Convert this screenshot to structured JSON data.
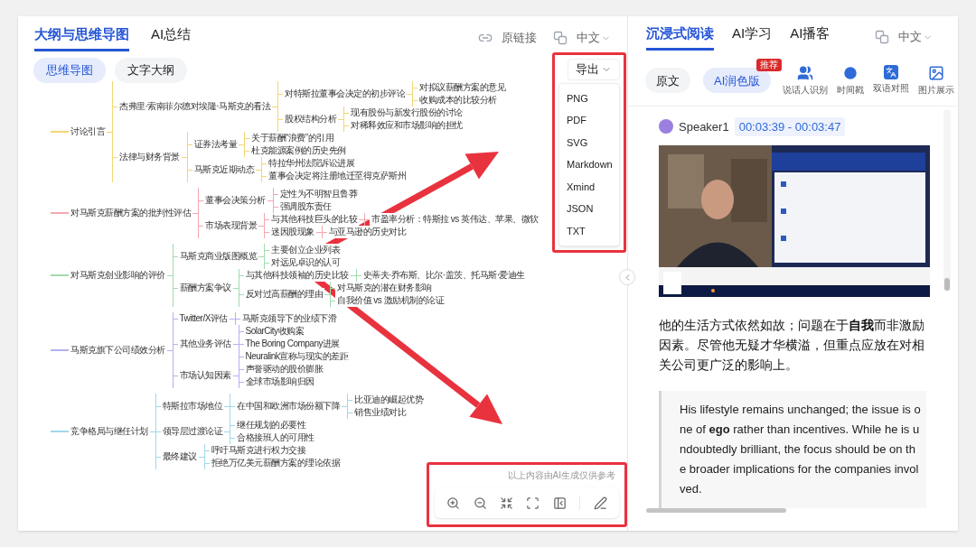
{
  "left_panel": {
    "tabs": [
      {
        "label": "大纲与思维导图",
        "selected": true
      },
      {
        "label": "AI总结",
        "selected": false
      }
    ],
    "source_link": "原链接",
    "language": "中文",
    "view_toggle": [
      {
        "label": "思维导图",
        "selected": true
      },
      {
        "label": "文字大纲",
        "selected": false
      }
    ],
    "mind_map": {
      "branches": [
        {
          "label": "讨论引言",
          "color": "#f2d675",
          "children": [
            {
              "label": "杰弗里·索南菲尔德对埃隆·马斯克的看法",
              "children": [
                {
                  "label": "对特斯拉董事会决定的初步评论",
                  "children": [
                    {
                      "label": "对拟议薪酬方案的意见"
                    },
                    {
                      "label": "收购成本的比较分析"
                    }
                  ]
                },
                {
                  "label": "股权结构分析",
                  "children": [
                    {
                      "label": "现有股份与新发行股份的讨论"
                    },
                    {
                      "label": "对稀释效应和市场影响的担忧"
                    }
                  ]
                }
              ]
            },
            {
              "label": "法律与财务背景",
              "children": [
                {
                  "label": "证券法考量",
                  "children": [
                    {
                      "label": "关于薪酬“浪费”的引用"
                    },
                    {
                      "label": "杜克能源案例的历史先例"
                    }
                  ]
                },
                {
                  "label": "马斯克近期动态",
                  "children": [
                    {
                      "label": "特拉华州法院诉讼进展"
                    },
                    {
                      "label": "董事会决定将注册地迁至得克萨斯州"
                    }
                  ]
                }
              ]
            }
          ]
        },
        {
          "label": "对马斯克薪酬方案的批判性评估",
          "color": "#f4a7b0",
          "children": [
            {
              "label": "董事会决策分析",
              "children": [
                {
                  "label": "定性为不明智且鲁莽"
                },
                {
                  "label": "强调股东责任"
                }
              ]
            },
            {
              "label": "市场表现背景",
              "children": [
                {
                  "label": "与其他科技巨头的比较",
                  "children": [
                    {
                      "label": "市盈率分析：特斯拉 vs 英伟达、苹果、微软"
                    }
                  ]
                },
                {
                  "label": "迷因股现象",
                  "children": [
                    {
                      "label": "与亚马逊的历史对比"
                    }
                  ]
                }
              ]
            }
          ]
        },
        {
          "label": "对马斯克创业影响的评价",
          "color": "#9fdcae",
          "children": [
            {
              "label": "马斯克商业版图概览",
              "children": [
                {
                  "label": "主要创立企业列表"
                },
                {
                  "label": "对远见卓识的认可"
                }
              ]
            },
            {
              "label": "薪酬方案争议",
              "children": [
                {
                  "label": "与其他科技领袖的历史比较",
                  "children": [
                    {
                      "label": "史蒂夫·乔布斯、比尔·盖茨、托马斯·爱迪生"
                    }
                  ]
                },
                {
                  "label": "反对过高薪酬的理由",
                  "children": [
                    {
                      "label": "对马斯克的潜在财务影响"
                    },
                    {
                      "label": "自我价值 vs 激励机制的论证"
                    }
                  ]
                }
              ]
            }
          ]
        },
        {
          "label": "马斯克旗下公司绩效分析",
          "color": "#b3b0f0",
          "children": [
            {
              "label": "Twitter/X评估",
              "children": [
                {
                  "label": "马斯克领导下的业绩下滑"
                }
              ]
            },
            {
              "label": "其他业务评估",
              "children": [
                {
                  "label": "SolarCity收购案"
                },
                {
                  "label": "The Boring Company进展"
                },
                {
                  "label": "Neuralink宣称与现实的差距"
                }
              ]
            },
            {
              "label": "市场认知因素",
              "children": [
                {
                  "label": "声誉驱动的股价膨胀"
                },
                {
                  "label": "全球市场影响归因"
                }
              ]
            }
          ]
        },
        {
          "label": "竞争格局与继任计划",
          "color": "#9fd8ea",
          "children": [
            {
              "label": "特斯拉市场地位",
              "children": [
                {
                  "label": "在中国和欧洲市场份额下降",
                  "children": [
                    {
                      "label": "比亚迪的崛起优势"
                    },
                    {
                      "label": "销售业绩对比"
                    }
                  ]
                }
              ]
            },
            {
              "label": "领导层过渡论证",
              "children": [
                {
                  "label": "继任规划的必要性"
                },
                {
                  "label": "合格接班人的可用性"
                }
              ]
            },
            {
              "label": "最终建议",
              "children": [
                {
                  "label": "呼吁马斯克进行权力交接"
                },
                {
                  "label": "拒绝万亿美元薪酬方案的理论依据"
                }
              ]
            }
          ]
        }
      ]
    },
    "export_menu": {
      "button": "导出",
      "options": [
        "PNG",
        "PDF",
        "SVG",
        "Markdown",
        "Xmind",
        "JSON",
        "TXT"
      ]
    },
    "disclaimer": "以上内容由AI生成仅供参考"
  },
  "right_panel": {
    "tabs": [
      {
        "label": "沉浸式阅读",
        "selected": true
      },
      {
        "label": "AI学习",
        "selected": false
      },
      {
        "label": "AI播客",
        "selected": false
      }
    ],
    "language": "中文",
    "versions": [
      {
        "label": "原文",
        "selected": false
      },
      {
        "label": "AI润色版",
        "selected": true,
        "badge": "推荐"
      }
    ],
    "tools": [
      {
        "kind": "speaker",
        "label": "说话人识别"
      },
      {
        "kind": "timestamp",
        "label": "时间戳"
      },
      {
        "kind": "bilingual",
        "label": "双语对照"
      },
      {
        "kind": "images",
        "label": "图片展示"
      }
    ],
    "speaker": {
      "name": "Speaker1",
      "time": "00:03:39 - 00:03:47"
    },
    "translation": "他的生活方式依然如故；问题在于**自我**而非激励因素。尽管他无疑才华横溢，但重点应放在对相关公司更广泛的影响上。",
    "original": "His lifestyle remains unchanged; the issue is one of **ego** rather than incentives. While he is undoubtedly brilliant, the focus should be on the broader implications for the companies involved."
  }
}
